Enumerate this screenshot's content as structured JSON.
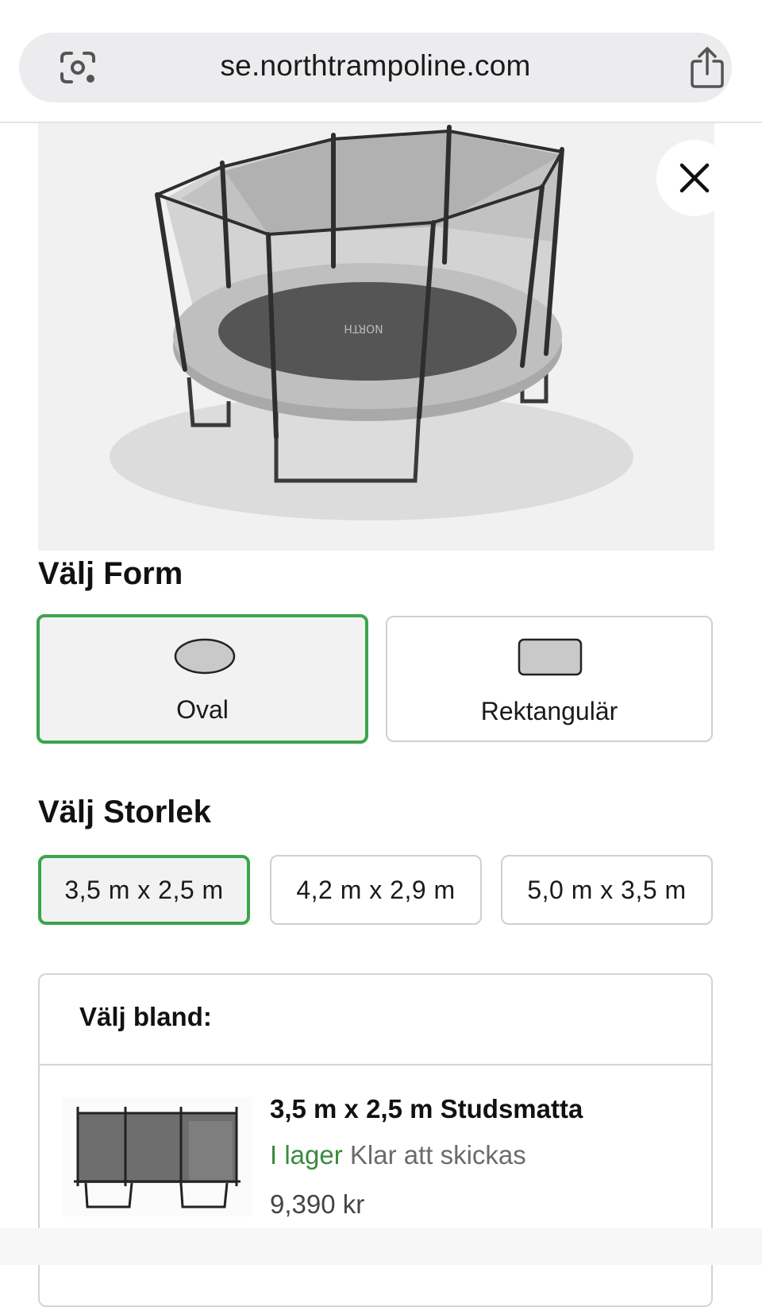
{
  "browser": {
    "url": "se.northtrampoline.com",
    "lens_icon": "lens-icon",
    "share_icon": "share-icon"
  },
  "hero": {
    "close_icon": "close-icon",
    "brand_mark": "NORTH"
  },
  "shape_section": {
    "title": "Välj Form",
    "options": [
      {
        "label": "Oval",
        "icon": "oval-shape-icon",
        "selected": true
      },
      {
        "label": "Rektangulär",
        "icon": "rectangle-shape-icon",
        "selected": false
      }
    ]
  },
  "size_section": {
    "title": "Välj Storlek",
    "options": [
      {
        "label": "3,5 m x 2,5 m",
        "selected": true
      },
      {
        "label": "4,2 m x 2,9 m",
        "selected": false
      },
      {
        "label": "5,0 m x 3,5 m",
        "selected": false
      }
    ]
  },
  "choose_among": {
    "title": "Välj bland:",
    "product": {
      "name": "3,5 m x 2,5 m Studsmatta",
      "stock_status": "I lager",
      "shipping": "Klar att skickas",
      "price": "9,390 kr"
    }
  },
  "colors": {
    "selected_border": "#3ba54a",
    "in_stock": "#3a8a3e"
  }
}
